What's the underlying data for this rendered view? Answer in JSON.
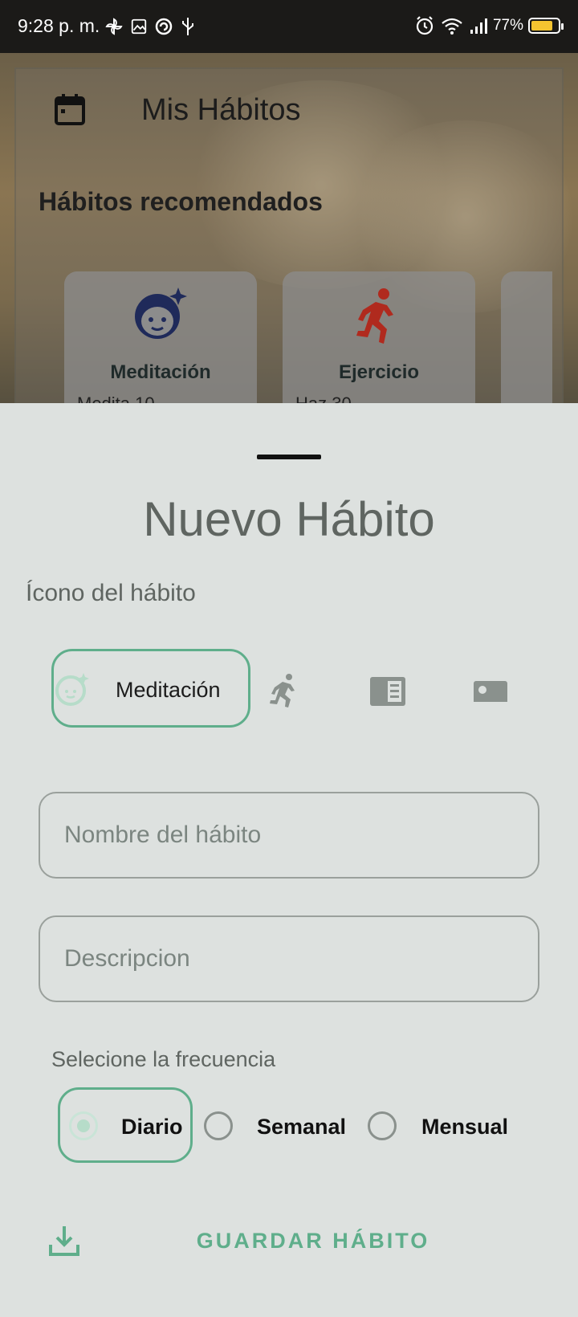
{
  "status_bar": {
    "time": "9:28 p. m.",
    "battery_text": "77%",
    "icons_left": [
      "pinwheel-icon",
      "image-icon",
      "vpn-icon",
      "usb-icon"
    ],
    "icons_right": [
      "alarm-icon",
      "wifi-icon",
      "signal-icon",
      "battery-icon"
    ]
  },
  "background": {
    "title": "Mis Hábitos",
    "section_title": "Hábitos recomendados",
    "cards": [
      {
        "label": "Meditación",
        "desc": "Medita 10 ...",
        "icon": "face-sparkle-icon",
        "icon_color": "#1f2a5a"
      },
      {
        "label": "Ejercicio",
        "desc": "Haz 30 ...",
        "icon": "running-icon",
        "icon_color": "#b02a1e"
      },
      {
        "label": "",
        "desc": "",
        "icon": "",
        "icon_color": ""
      }
    ]
  },
  "sheet": {
    "title": "Nuevo Hábito",
    "icon_section_label": "Ícono del hábito",
    "icon_options": [
      {
        "label": "Meditación",
        "icon": "face-sparkle-icon",
        "selected": true
      },
      {
        "label": "",
        "icon": "running-icon",
        "selected": false
      },
      {
        "label": "",
        "icon": "book-icon",
        "selected": false
      },
      {
        "label": "",
        "icon": "bed-icon",
        "selected": false
      }
    ],
    "name_field": {
      "placeholder": "Nombre del hábito",
      "value": ""
    },
    "desc_field": {
      "placeholder": "Descripcion",
      "value": ""
    },
    "frequency_label": "Selecione la frecuencia",
    "frequency_options": [
      {
        "label": "Diario",
        "selected": true
      },
      {
        "label": "Semanal",
        "selected": false
      },
      {
        "label": "Mensual",
        "selected": false
      }
    ],
    "save_label": "GUARDAR HÁBITO"
  },
  "colors": {
    "accent": "#5fae8b",
    "sheet_bg": "#dde1df",
    "icon_muted": "#8a918d"
  }
}
